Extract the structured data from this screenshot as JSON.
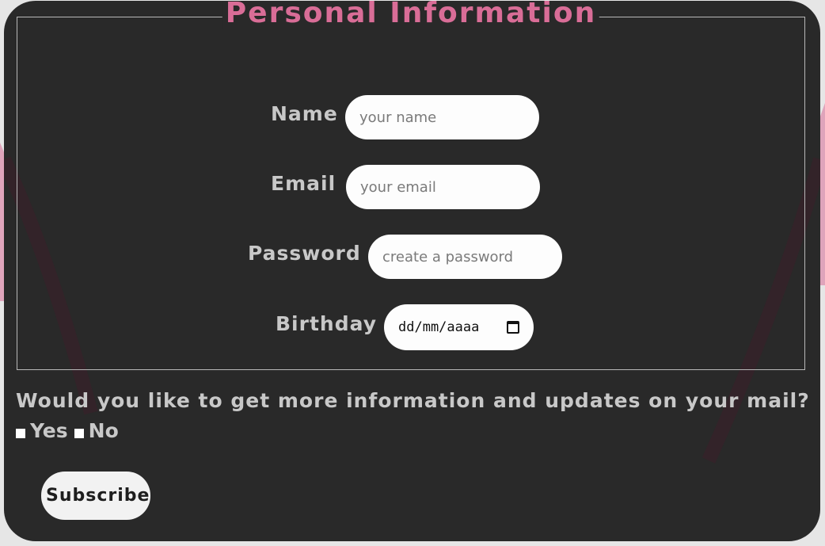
{
  "form": {
    "legend": "Personal Information",
    "fields": {
      "name": {
        "label": "Name",
        "placeholder": "your name"
      },
      "email": {
        "label": "Email",
        "placeholder": "your email"
      },
      "password": {
        "label": "Password",
        "placeholder": "create a password"
      },
      "birthday": {
        "label": "Birthday",
        "value": "dd/mm/aaaa",
        "icon": "calendar-icon"
      }
    },
    "question": "Would you like to get more information and updates on your mail?",
    "options": [
      "Yes",
      "No"
    ],
    "submit_label": "Subscribe"
  },
  "colors": {
    "page_background": "#e6e6e6",
    "card_background": "#292929",
    "accent": "#d96d97",
    "label_text": "#c8c8c8",
    "input_background": "#fdfdfd"
  }
}
